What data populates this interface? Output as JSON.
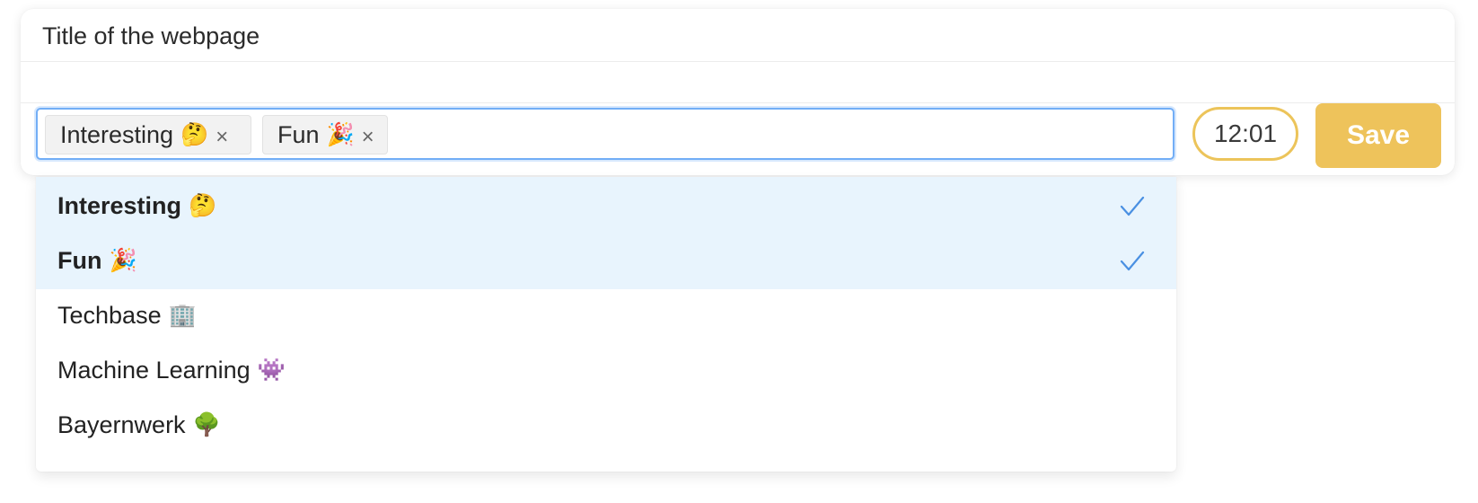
{
  "page": {
    "title": "Title of the webpage"
  },
  "tag_input": {
    "chips": [
      {
        "label": "Interesting",
        "emoji": "🤔",
        "remove": "×"
      },
      {
        "label": "Fun",
        "emoji": "🎉",
        "remove": "×"
      }
    ]
  },
  "time": "12:01",
  "save_label": "Save",
  "dropdown": {
    "options": [
      {
        "label": "Interesting",
        "emoji": "🤔",
        "selected": true
      },
      {
        "label": "Fun",
        "emoji": "🎉",
        "selected": true
      },
      {
        "label": "Techbase",
        "emoji": "🏢",
        "selected": false
      },
      {
        "label": "Machine Learning",
        "emoji": "👾",
        "selected": false
      },
      {
        "label": "Bayernwerk",
        "emoji": "🌳",
        "selected": false
      }
    ]
  },
  "colors": {
    "accent": "#eec35b",
    "focus_border": "#72aef6",
    "selected_bg": "#e8f4fd",
    "check": "#4a90e2"
  }
}
